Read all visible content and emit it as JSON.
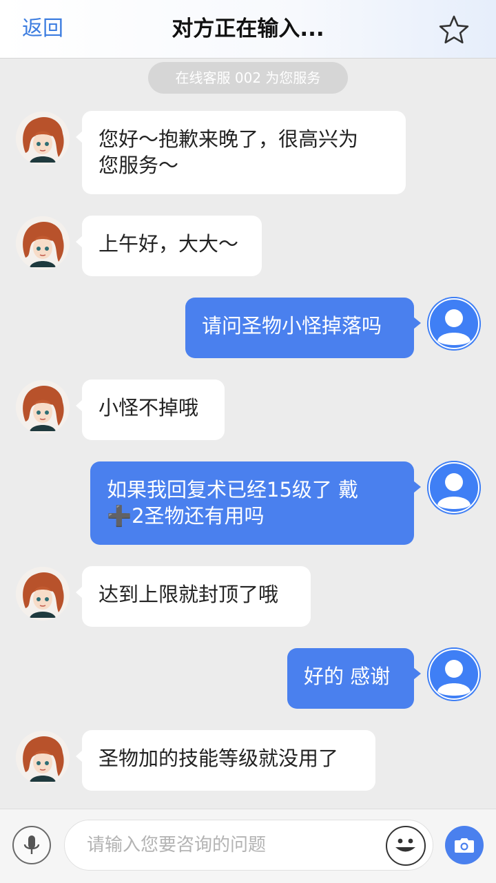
{
  "header": {
    "back_label": "返回",
    "title": "对方正在输入..."
  },
  "system_notice": "在线客服 002 为您服务",
  "messages": [
    {
      "side": "left",
      "text": "您好～抱歉来晚了，很高兴为\n您服务～"
    },
    {
      "side": "left",
      "text": "上午好，大大～"
    },
    {
      "side": "right",
      "text": "请问圣物小怪掉落吗"
    },
    {
      "side": "left",
      "text": "小怪不掉哦"
    },
    {
      "side": "right",
      "text": "如果我回复术已经15级了 戴\n➕2圣物还有用吗"
    },
    {
      "side": "left",
      "text": "达到上限就封顶了哦"
    },
    {
      "side": "right",
      "text": "好的 感谢"
    },
    {
      "side": "left",
      "text": "圣物加的技能等级就没用了"
    }
  ],
  "input_bar": {
    "placeholder": "请输入您要咨询的问题"
  },
  "colors": {
    "accent": "#4a80ee",
    "link": "#3d7de0",
    "background": "#ececec",
    "agent_bubble": "#ffffff"
  },
  "icons": {
    "favorite": "star-icon",
    "voice": "microphone-icon",
    "emoji": "smiley-icon",
    "photo": "camera-icon"
  }
}
